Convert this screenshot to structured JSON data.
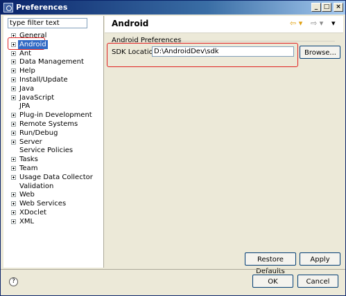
{
  "window": {
    "title": "Preferences"
  },
  "filter": {
    "placeholder": "type filter text",
    "value": "type filter text"
  },
  "tree": [
    {
      "label": "General",
      "expandable": true
    },
    {
      "label": "Android",
      "expandable": true,
      "selected": true
    },
    {
      "label": "Ant",
      "expandable": true
    },
    {
      "label": "Data Management",
      "expandable": true
    },
    {
      "label": "Help",
      "expandable": true
    },
    {
      "label": "Install/Update",
      "expandable": true
    },
    {
      "label": "Java",
      "expandable": true
    },
    {
      "label": "JavaScript",
      "expandable": true
    },
    {
      "label": "JPA",
      "expandable": false
    },
    {
      "label": "Plug-in Development",
      "expandable": true
    },
    {
      "label": "Remote Systems",
      "expandable": true
    },
    {
      "label": "Run/Debug",
      "expandable": true
    },
    {
      "label": "Server",
      "expandable": true
    },
    {
      "label": "Service Policies",
      "expandable": false
    },
    {
      "label": "Tasks",
      "expandable": true
    },
    {
      "label": "Team",
      "expandable": true
    },
    {
      "label": "Usage Data Collector",
      "expandable": true
    },
    {
      "label": "Validation",
      "expandable": false
    },
    {
      "label": "Web",
      "expandable": true
    },
    {
      "label": "Web Services",
      "expandable": true
    },
    {
      "label": "XDoclet",
      "expandable": true
    },
    {
      "label": "XML",
      "expandable": true
    }
  ],
  "page": {
    "title": "Android",
    "group_title": "Android Preferences",
    "sdk_label": "SDK Location:",
    "sdk_value": "D:\\AndroidDev\\sdk",
    "browse_label": "Browse..."
  },
  "buttons": {
    "restore_defaults": "Restore Defaults",
    "apply": "Apply",
    "ok": "OK",
    "cancel": "Cancel"
  },
  "icons": {
    "back": "arrow-left-icon",
    "forward": "arrow-right-icon",
    "menu": "chevron-down-icon",
    "help": "help-icon"
  }
}
